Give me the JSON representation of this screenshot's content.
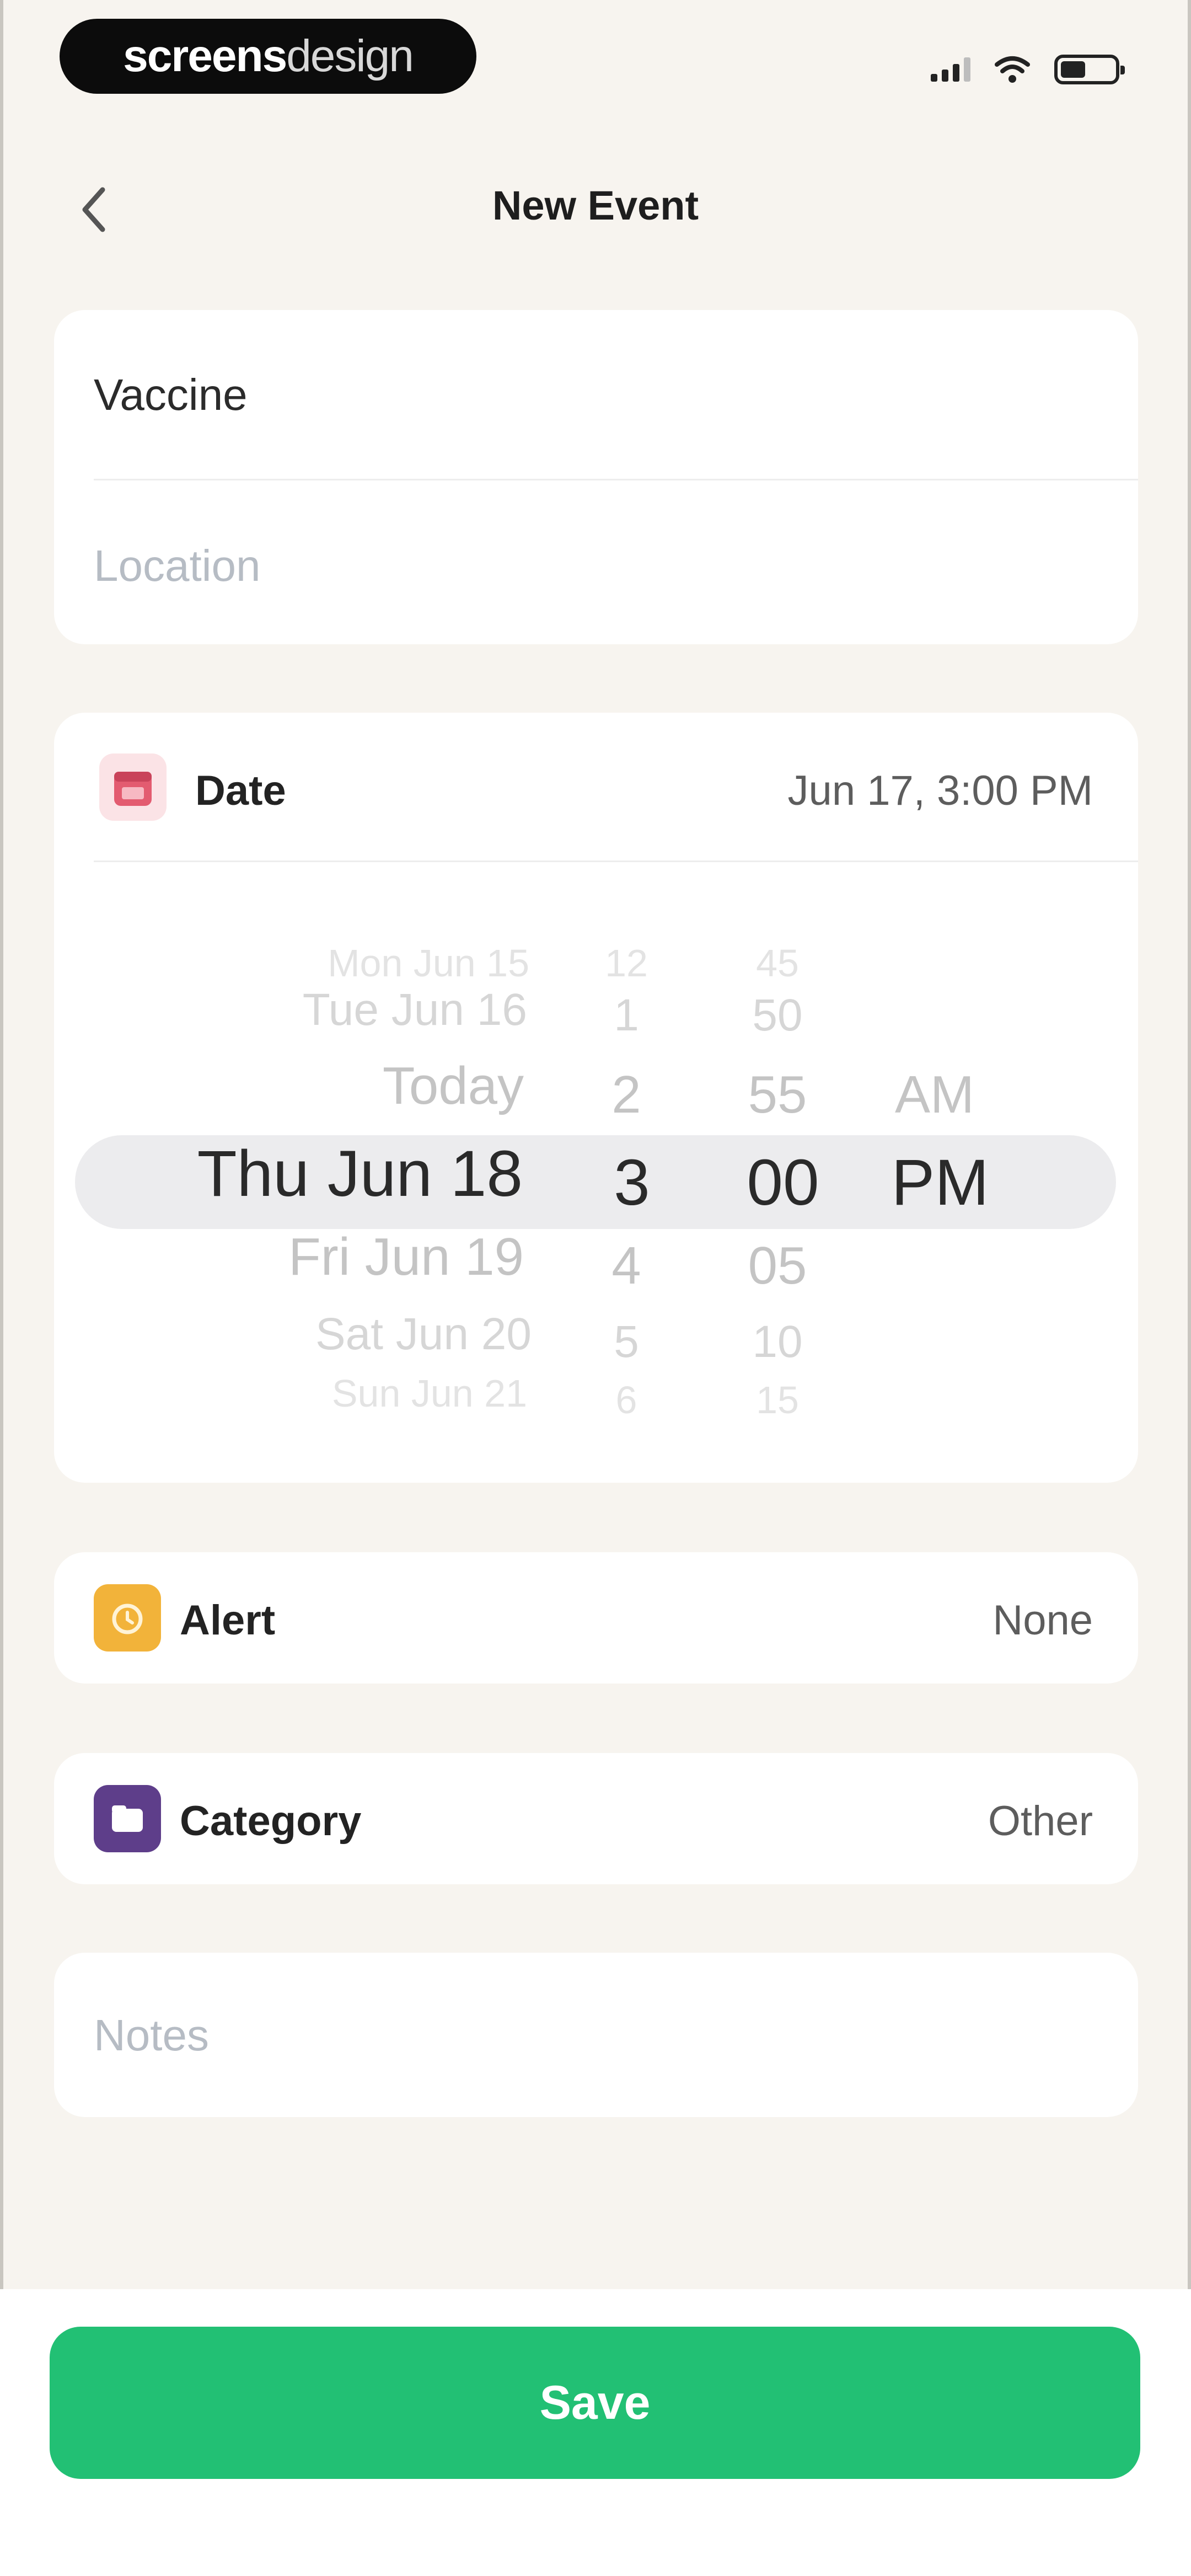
{
  "status_bar": {
    "brand_bold": "screens",
    "brand_light": "design"
  },
  "header": {
    "title": "New Event"
  },
  "event": {
    "title_value": "Vaccine",
    "location_placeholder": "Location",
    "notes_placeholder": "Notes"
  },
  "date_row": {
    "label": "Date",
    "value": "Jun 17, 3:00 PM",
    "icon_color": "#e35b70"
  },
  "picker": {
    "dates": [
      "Mon Jun 15",
      "Tue Jun 16",
      "Today",
      "Thu Jun 18",
      "Fri Jun 19",
      "Sat Jun 20",
      "Sun Jun 21"
    ],
    "hours": [
      "12",
      "1",
      "2",
      "3",
      "4",
      "5",
      "6"
    ],
    "minutes": [
      "45",
      "50",
      "55",
      "00",
      "05",
      "10",
      "15"
    ],
    "periods": [
      "AM",
      "PM"
    ],
    "selected": {
      "date": "Thu Jun 18",
      "hour": "3",
      "minute": "00",
      "period": "PM"
    }
  },
  "alert_row": {
    "label": "Alert",
    "value": "None",
    "icon_color": "#f2b33a"
  },
  "category_row": {
    "label": "Category",
    "value": "Other",
    "icon_color": "#5e3e8a"
  },
  "actions": {
    "save_label": "Save",
    "save_color": "#22c074"
  }
}
